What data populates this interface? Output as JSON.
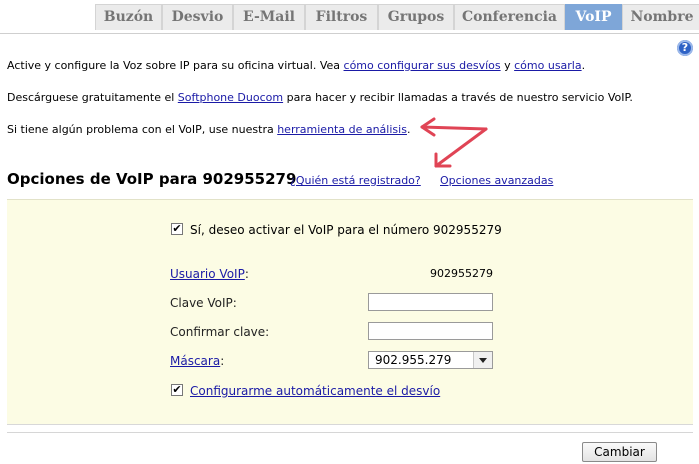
{
  "tabs": [
    {
      "label": "Buzón",
      "active": false
    },
    {
      "label": "Desvio",
      "active": false
    },
    {
      "label": "E-Mail",
      "active": false
    },
    {
      "label": "Filtros",
      "active": false
    },
    {
      "label": "Grupos",
      "active": false
    },
    {
      "label": "Conferencia",
      "active": false
    },
    {
      "label": "VoIP",
      "active": true
    },
    {
      "label": "Nombre",
      "active": false
    }
  ],
  "help": {
    "glyph": "?"
  },
  "intro": {
    "p1": {
      "text_a": "Active y configure la Voz sobre IP para su oficina virtual. Vea ",
      "link_a": "cómo configurar sus desvíos",
      "text_b": " y ",
      "link_b": "cómo usarla",
      "text_c": "."
    },
    "p2": {
      "text_a": "Descárguese gratuitamente el ",
      "link": "Softphone Duocom",
      "text_b": " para hacer y recibir llamadas a través de nuestro servicio VoIP."
    },
    "p3": {
      "text_a": "Si tiene algún problema con el VoIP, use nuestra ",
      "link": "herramienta de análisis",
      "text_b": "."
    }
  },
  "section": {
    "title": "Opciones de VoIP para 902955279",
    "who_link": "¿Quién está registrado?",
    "advanced_link": "Opciones avanzadas"
  },
  "form": {
    "activate_checked": true,
    "activate_label": "Sí, deseo activar el VoIP para el número 902955279",
    "user_label": "Usuario VoIP",
    "user_value": "902955279",
    "password_label": "Clave VoIP:",
    "password_value": "",
    "confirm_label": "Confirmar clave:",
    "confirm_value": "",
    "mask_label": "Máscara",
    "mask_value": "902.955.279",
    "autoconfig_checked": true,
    "autoconfig_label": "Configurarme automáticamente el desvío",
    "submit_label": "Cambiar",
    "check_glyph": "✔",
    "colon": ":"
  },
  "colors": {
    "active_tab": "#7ea6d8",
    "panel_bg": "#fcfce4",
    "link": "#1a1aa6",
    "annotation_arrow": "#e04455"
  }
}
